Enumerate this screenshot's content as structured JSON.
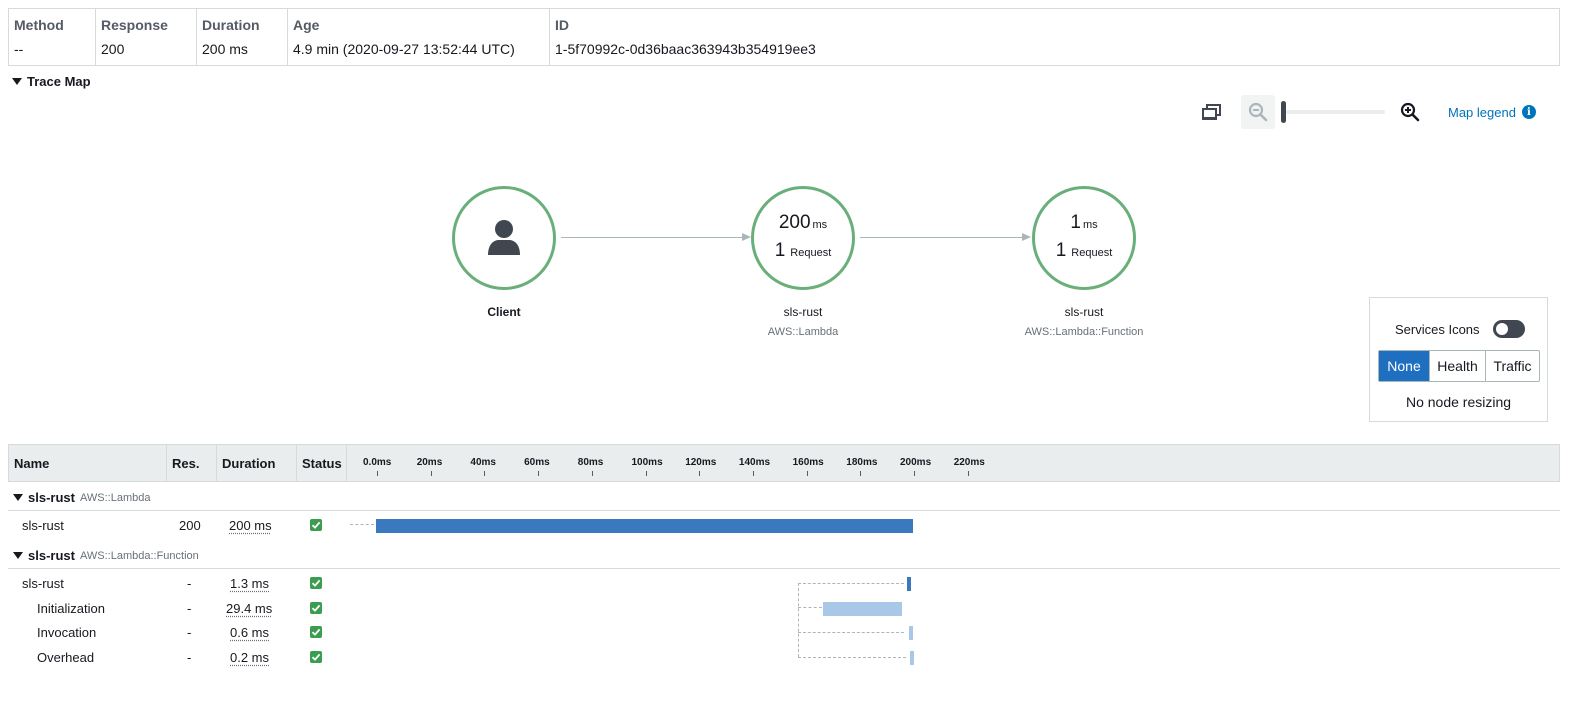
{
  "summary": {
    "headers": {
      "method": "Method",
      "response": "Response",
      "duration": "Duration",
      "age": "Age",
      "id": "ID"
    },
    "values": {
      "method": "--",
      "response": "200",
      "duration": "200 ms",
      "age": "4.9 min (2020-09-27 13:52:44 UTC)",
      "id": "1-5f70992c-0d36baac363943b354919ee3"
    }
  },
  "trace_map": {
    "section_title": "Trace Map",
    "toolbar": {
      "legend_label": "Map legend",
      "zoom_level": 0
    },
    "nodes": [
      {
        "name": "Client",
        "type": "",
        "icon": "user-icon"
      },
      {
        "name": "sls-rust",
        "type": "AWS::Lambda",
        "latency": "200",
        "latency_unit": "ms",
        "requests": "1",
        "requests_label": "Request"
      },
      {
        "name": "sls-rust",
        "type": "AWS::Lambda::Function",
        "latency": "1",
        "latency_unit": "ms",
        "requests": "1",
        "requests_label": "Request"
      }
    ],
    "panel": {
      "services_icons_label": "Services Icons",
      "services_icons_on": false,
      "seg_options": [
        "None",
        "Health",
        "Traffic"
      ],
      "seg_selected": "None",
      "resize_text": "No node resizing"
    }
  },
  "timeline": {
    "columns": {
      "name": "Name",
      "res": "Res.",
      "duration": "Duration",
      "status": "Status"
    },
    "ticks": [
      "0.0ms",
      "20ms",
      "40ms",
      "60ms",
      "80ms",
      "100ms",
      "120ms",
      "140ms",
      "160ms",
      "180ms",
      "200ms",
      "220ms"
    ],
    "groups": [
      {
        "name": "sls-rust",
        "type": "AWS::Lambda",
        "rows": [
          {
            "name": "sls-rust",
            "res": "200",
            "duration": "200 ms",
            "status": "ok",
            "start_ms": 0,
            "dur_ms": 200,
            "color": "#3a79bd"
          }
        ]
      },
      {
        "name": "sls-rust",
        "type": "AWS::Lambda::Function",
        "rows": [
          {
            "name": "sls-rust",
            "res": "-",
            "duration": "1.3 ms",
            "status": "ok",
            "start_ms": 197.8,
            "dur_ms": 1.3,
            "color": "#3a79bd"
          },
          {
            "name": "Initialization",
            "res": "-",
            "duration": "29.4 ms",
            "status": "ok",
            "start_ms": 166.5,
            "dur_ms": 29.4,
            "color": "#a9c8e8"
          },
          {
            "name": "Invocation",
            "res": "-",
            "duration": "0.6 ms",
            "status": "ok",
            "start_ms": 198.6,
            "dur_ms": 0.6,
            "color": "#a9c8e8"
          },
          {
            "name": "Overhead",
            "res": "-",
            "duration": "0.2 ms",
            "status": "ok",
            "start_ms": 199.0,
            "dur_ms": 0.2,
            "color": "#a9c8e8"
          }
        ]
      }
    ]
  }
}
